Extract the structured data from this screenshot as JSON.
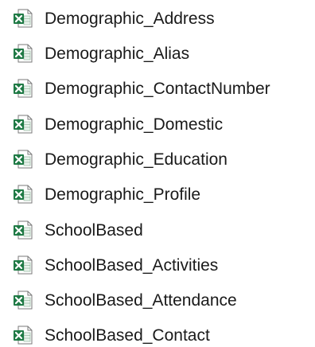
{
  "files": [
    {
      "name": "Demographic_Address",
      "icon": "excel-file-icon"
    },
    {
      "name": "Demographic_Alias",
      "icon": "excel-file-icon"
    },
    {
      "name": "Demographic_ContactNumber",
      "icon": "excel-file-icon"
    },
    {
      "name": "Demographic_Domestic",
      "icon": "excel-file-icon"
    },
    {
      "name": "Demographic_Education",
      "icon": "excel-file-icon"
    },
    {
      "name": "Demographic_Profile",
      "icon": "excel-file-icon"
    },
    {
      "name": "SchoolBased",
      "icon": "excel-file-icon"
    },
    {
      "name": "SchoolBased_Activities",
      "icon": "excel-file-icon"
    },
    {
      "name": "SchoolBased_Attendance",
      "icon": "excel-file-icon"
    },
    {
      "name": "SchoolBased_Contact",
      "icon": "excel-file-icon"
    }
  ],
  "colors": {
    "excel_green": "#1f7a45",
    "excel_dark": "#185c37",
    "page_bg": "#ffffff"
  }
}
